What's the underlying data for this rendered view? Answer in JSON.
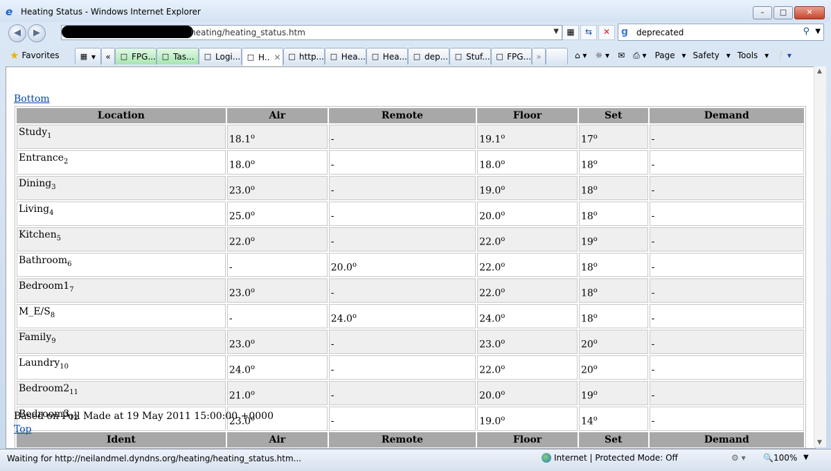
{
  "window": {
    "title": "Heating Status - Windows Internet Explorer"
  },
  "address": {
    "url": "heating/heating_status.htm"
  },
  "search": {
    "value": "deprecated"
  },
  "favorites_label": "Favorites",
  "tabs": [
    {
      "label": "FPG...",
      "style": "green"
    },
    {
      "label": "Tas...",
      "style": "green"
    },
    {
      "label": "Logi...",
      "style": "normal"
    },
    {
      "label": "H..",
      "style": "active"
    },
    {
      "label": "http...",
      "style": "normal"
    },
    {
      "label": "Hea...",
      "style": "normal"
    },
    {
      "label": "Hea...",
      "style": "normal"
    },
    {
      "label": "dep...",
      "style": "normal"
    },
    {
      "label": "Stuf...",
      "style": "normal"
    },
    {
      "label": "FPG...",
      "style": "normal"
    }
  ],
  "toolbar": {
    "page": "Page",
    "safety": "Safety",
    "tools": "Tools"
  },
  "page": {
    "bottom_link": "Bottom",
    "top_link": "Top",
    "poll_text": "Based on Poll Made at 19 May 2011 15:00:00 +0000",
    "headers": [
      "Location",
      "Air",
      "Remote",
      "Floor",
      "Set",
      "Demand"
    ],
    "footer_headers": [
      "Ident",
      "Air",
      "Remote",
      "Floor",
      "Set",
      "Demand"
    ],
    "rows": [
      {
        "name": "Study",
        "id": "1",
        "air": "18.1",
        "remote": "-",
        "floor": "19.1",
        "set": "17",
        "demand": "-"
      },
      {
        "name": "Entrance",
        "id": "2",
        "air": "18.0",
        "remote": "-",
        "floor": "18.0",
        "set": "18",
        "demand": "-"
      },
      {
        "name": "Dining",
        "id": "3",
        "air": "23.0",
        "remote": "-",
        "floor": "19.0",
        "set": "18",
        "demand": "-"
      },
      {
        "name": "Living",
        "id": "4",
        "air": "25.0",
        "remote": "-",
        "floor": "20.0",
        "set": "18",
        "demand": "-"
      },
      {
        "name": "Kitchen",
        "id": "5",
        "air": "22.0",
        "remote": "-",
        "floor": "22.0",
        "set": "19",
        "demand": "-"
      },
      {
        "name": "Bathroom",
        "id": "6",
        "air": "-",
        "remote": "20.0",
        "floor": "22.0",
        "set": "18",
        "demand": "-"
      },
      {
        "name": "Bedroom1",
        "id": "7",
        "air": "23.0",
        "remote": "-",
        "floor": "22.0",
        "set": "18",
        "demand": "-"
      },
      {
        "name": "M_E/S",
        "id": "8",
        "air": "-",
        "remote": "24.0",
        "floor": "24.0",
        "set": "18",
        "demand": "-"
      },
      {
        "name": "Family",
        "id": "9",
        "air": "23.0",
        "remote": "-",
        "floor": "23.0",
        "set": "20",
        "demand": "-"
      },
      {
        "name": "Laundry",
        "id": "10",
        "air": "24.0",
        "remote": "-",
        "floor": "22.0",
        "set": "20",
        "demand": "-"
      },
      {
        "name": "Bedroom2",
        "id": "11",
        "air": "21.0",
        "remote": "-",
        "floor": "20.0",
        "set": "19",
        "demand": "-"
      },
      {
        "name": "Bedroom3",
        "id": "12",
        "air": "23.0",
        "remote": "-",
        "floor": "19.0",
        "set": "14",
        "demand": "-"
      }
    ]
  },
  "status": {
    "text": "Waiting for http://neilandmel.dyndns.org/heating/heating_status.htm...",
    "zone": "Internet | Protected Mode: Off",
    "zoom": "100%"
  }
}
